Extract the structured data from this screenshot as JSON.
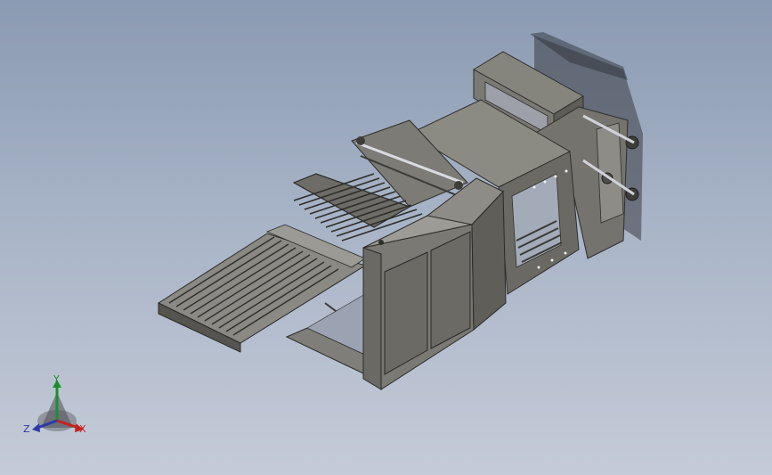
{
  "triad": {
    "x_label": "X",
    "y_label": "Y",
    "z_label": "Z"
  },
  "colors": {
    "background_top": "#8a9ab2",
    "background_bottom": "#c5cbd8",
    "machine_body": "#6f6e68",
    "machine_dark": "#4a4a46",
    "axis_x": "#c42121",
    "axis_y": "#1c8f2c",
    "axis_z": "#2a3aa6"
  },
  "icons": [
    "coordinate-triad-icon"
  ]
}
